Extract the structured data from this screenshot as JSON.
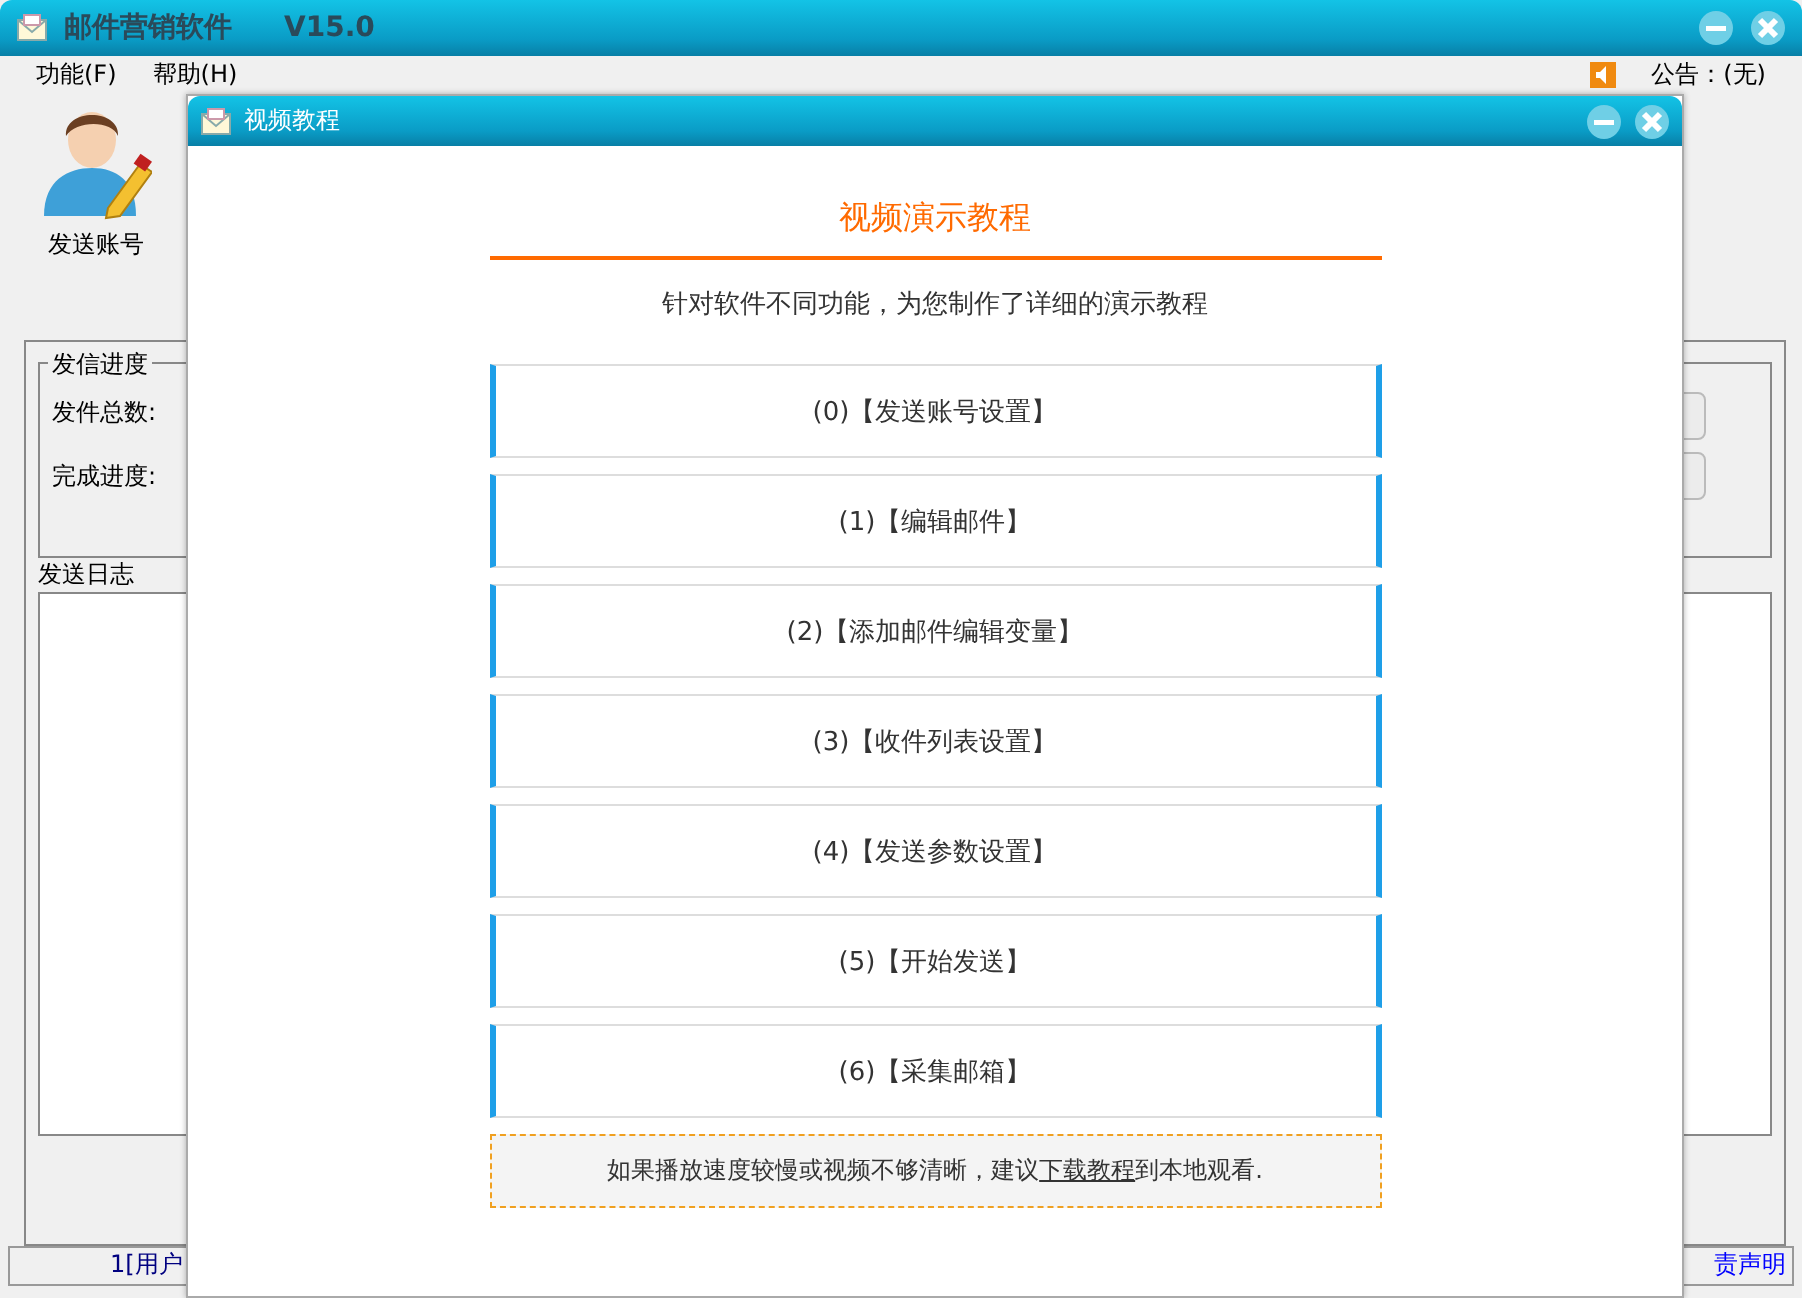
{
  "main_window": {
    "title": "邮件营销软件",
    "version": "V15.0"
  },
  "menu": [
    "功能(F)",
    "帮助(H)"
  ],
  "notice": {
    "label": "公告：(无)"
  },
  "toolbar": [
    {
      "label": "发送账号"
    }
  ],
  "progress_group": {
    "title": "发信进度",
    "fields": [
      "发件总数:",
      "完成进度:"
    ]
  },
  "log": {
    "title": "发送日志"
  },
  "status_bar": {
    "left": "1[用户",
    "right": "责声明"
  },
  "dialog": {
    "title": "视频教程",
    "heading": "视频演示教程",
    "subtitle": "针对软件不同功能，为您制作了详细的演示教程",
    "items": [
      {
        "label": "(0)【发送账号设置】"
      },
      {
        "label": "(1)【编辑邮件】"
      },
      {
        "label": "(2)【添加邮件编辑变量】"
      },
      {
        "label": "(3)【收件列表设置】"
      },
      {
        "label": "(4)【发送参数设置】"
      },
      {
        "label": "(5)【开始发送】"
      },
      {
        "label": "(6)【采集邮箱】"
      }
    ],
    "footer": {
      "before": "如果播放速度较慢或视频不够清晰，建议",
      "link": "下载教程",
      "after": "到本地观看."
    }
  }
}
